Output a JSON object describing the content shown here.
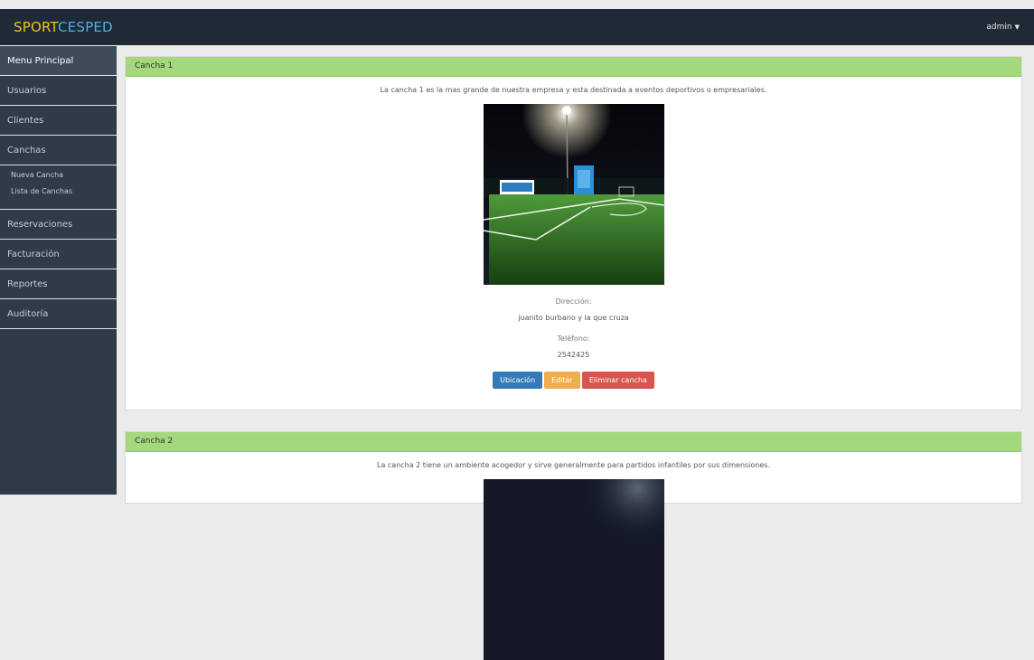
{
  "brand": {
    "part1": "SPORT",
    "part2": "CESPED"
  },
  "user_menu": {
    "label": "admin"
  },
  "sidebar": {
    "items": [
      {
        "label": "Menu Principal"
      },
      {
        "label": "Usuarios"
      },
      {
        "label": "Clientes"
      },
      {
        "label": "Canchas"
      },
      {
        "label": "Reservaciones"
      },
      {
        "label": "Facturación"
      },
      {
        "label": "Reportes"
      },
      {
        "label": "Auditoría"
      }
    ],
    "canchas_sub": [
      {
        "label": "Nueva Cancha"
      },
      {
        "label": "Lista de Canchas"
      }
    ]
  },
  "canchas": [
    {
      "title": "Cancha 1",
      "description": "La cancha 1 es la mas grande de nuestra empresa y esta destinada a eventos deportivos o empresariales.",
      "direccion_label": "Dirección:",
      "direccion": "juanito burbano y la que cruza",
      "telefono_label": "Teléfono:",
      "telefono": "2542425",
      "buttons": {
        "ubicacion": "Ubicación",
        "editar": "Editar",
        "eliminar": "Eliminar cancha"
      }
    },
    {
      "title": "Cancha 2",
      "description": "La cancha 2 tiene un ambiente acogedor y sirve generalmente para partidos infantiles por sus dimensiones."
    }
  ],
  "colors": {
    "topbar": "#1f2a36",
    "sidebar": "#2e3b48",
    "panel_header": "#a3d87d",
    "btn_blue": "#337ab7",
    "btn_orange": "#f0ad4e",
    "btn_red": "#d9534f"
  }
}
